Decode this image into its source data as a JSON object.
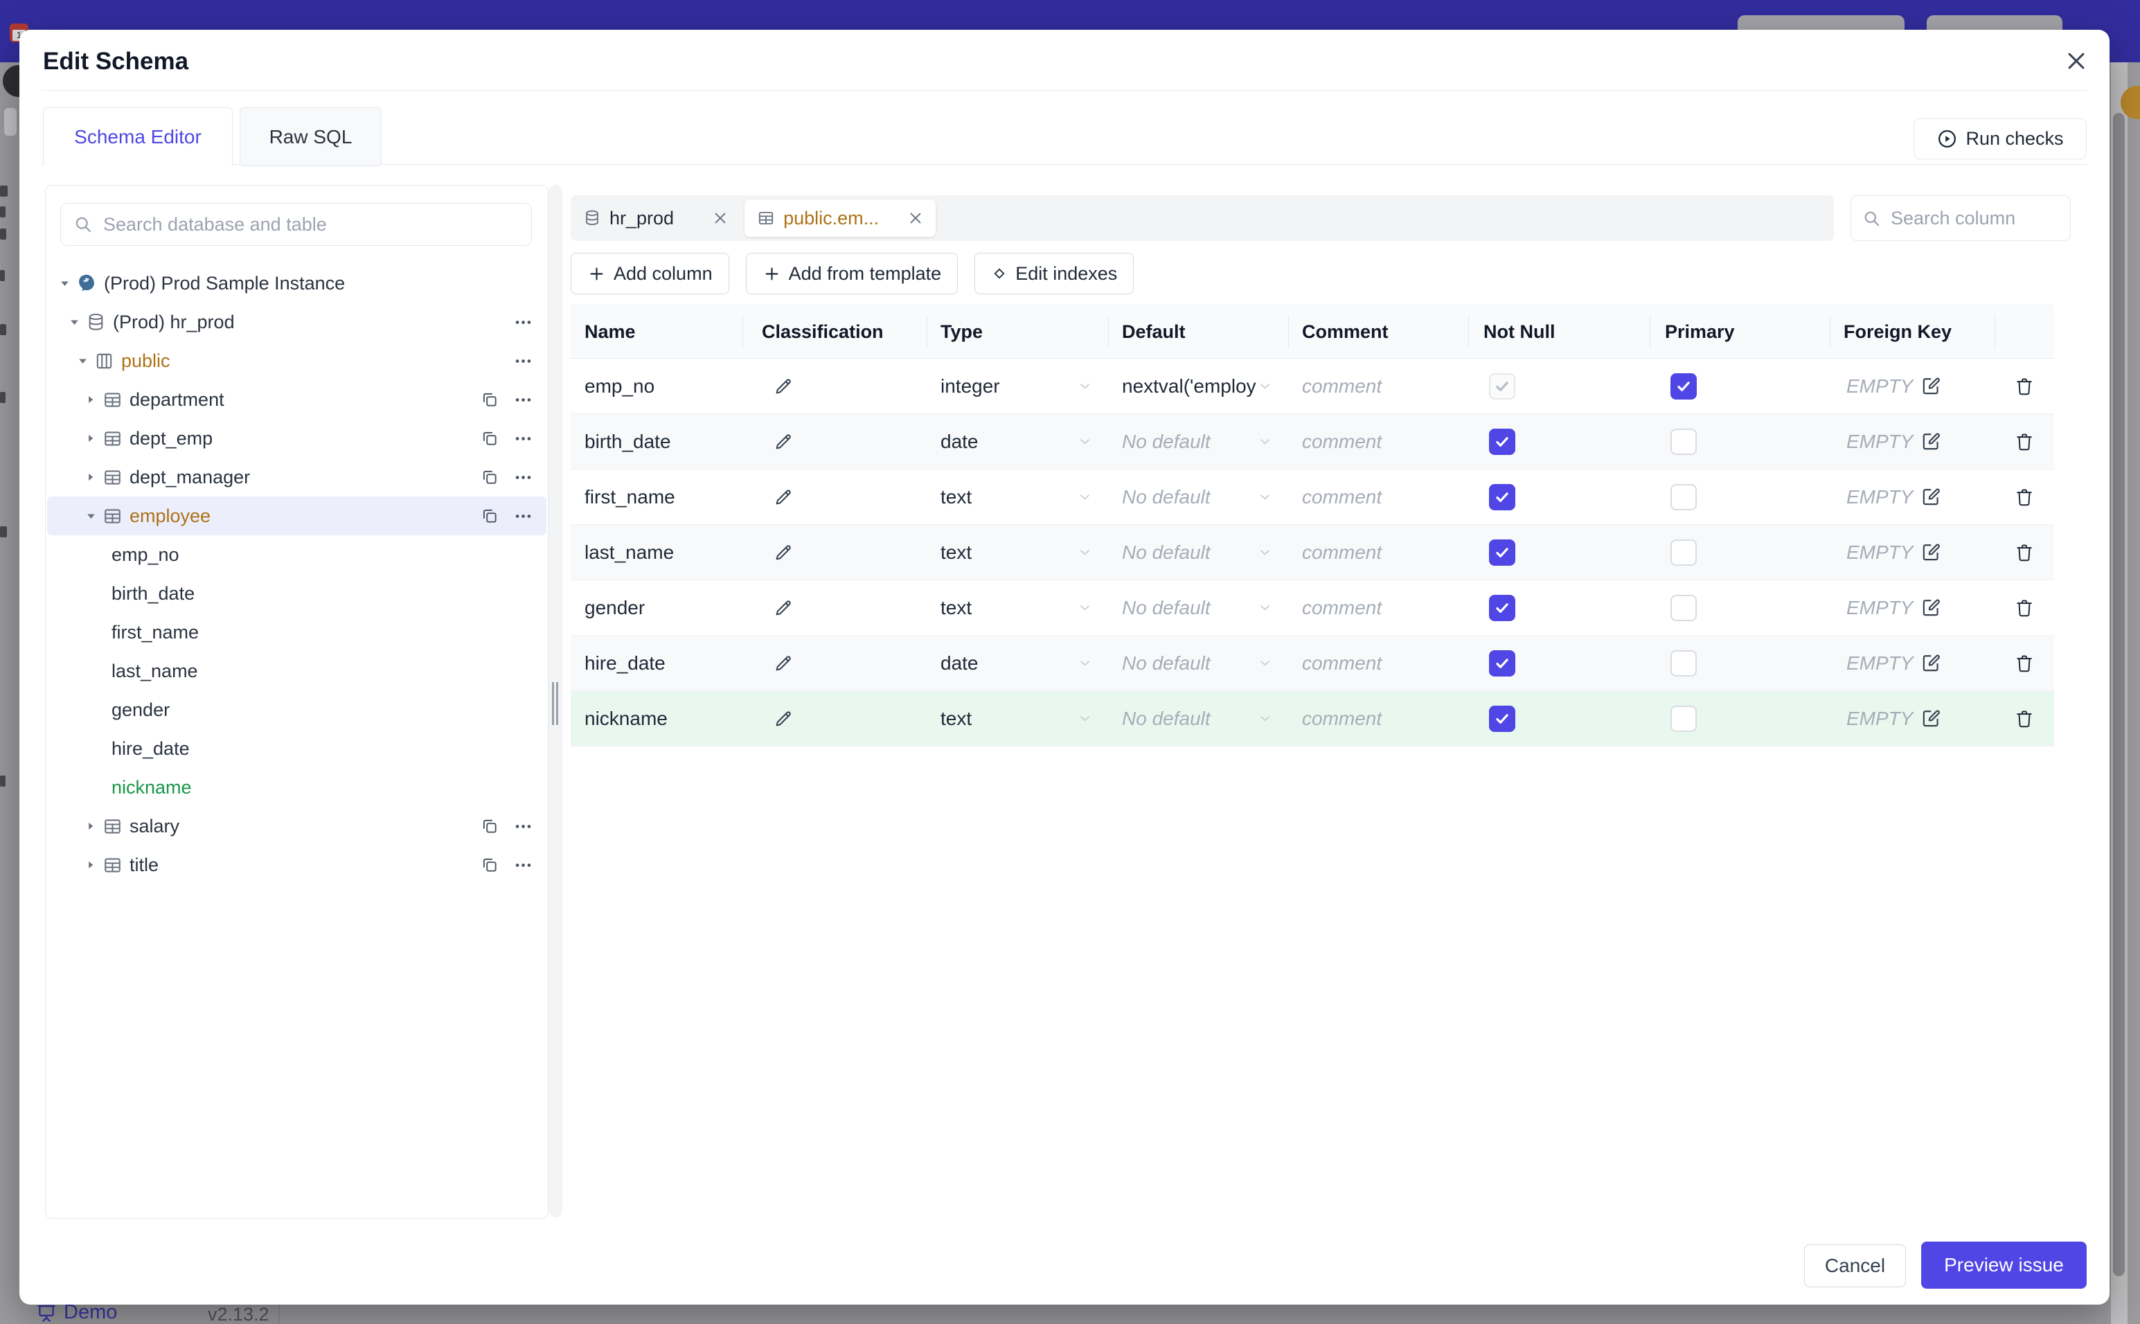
{
  "colors": {
    "accent": "#4f46e5",
    "topbar_dimmed": "#322d9e",
    "amber_highlight": "#ac7216",
    "green_new": "#1a9648",
    "new_row_bg": "#e9f8ef",
    "selected_tree_bg": "#eceefc"
  },
  "background": {
    "brand": "Demo",
    "version": "v2.13.2"
  },
  "modal": {
    "title": "Edit Schema",
    "tabs": {
      "schema_editor": "Schema Editor",
      "raw_sql": "Raw SQL"
    },
    "run_checks": "Run checks",
    "sidebar": {
      "search_placeholder": "Search database and table",
      "tree": [
        {
          "label": "(Prod) Prod Sample Instance",
          "level": 0,
          "icon": "postgresql",
          "expanded": true
        },
        {
          "label": "(Prod) hr_prod",
          "level": 1,
          "icon": "database",
          "expanded": true
        },
        {
          "label": "public",
          "level": 2,
          "icon": "schema",
          "expanded": true,
          "color": "amber"
        },
        {
          "label": "department",
          "level": 3,
          "icon": "table",
          "expanded": false
        },
        {
          "label": "dept_emp",
          "level": 3,
          "icon": "table",
          "expanded": false
        },
        {
          "label": "dept_manager",
          "level": 3,
          "icon": "table",
          "expanded": false
        },
        {
          "label": "employee",
          "level": 3,
          "icon": "table",
          "expanded": true,
          "color": "amber",
          "selected": true
        },
        {
          "label": "emp_no",
          "level": 4,
          "icon": "none"
        },
        {
          "label": "birth_date",
          "level": 4,
          "icon": "none"
        },
        {
          "label": "first_name",
          "level": 4,
          "icon": "none"
        },
        {
          "label": "last_name",
          "level": 4,
          "icon": "none"
        },
        {
          "label": "gender",
          "level": 4,
          "icon": "none"
        },
        {
          "label": "hire_date",
          "level": 4,
          "icon": "none"
        },
        {
          "label": "nickname",
          "level": 4,
          "icon": "none",
          "color": "green"
        },
        {
          "label": "salary",
          "level": 3,
          "icon": "table",
          "expanded": false
        },
        {
          "label": "title",
          "level": 3,
          "icon": "table",
          "expanded": false
        }
      ]
    },
    "editor": {
      "chips": [
        {
          "label": "hr_prod",
          "icon": "database",
          "active": false
        },
        {
          "label": "public.em...",
          "icon": "table",
          "active": true
        }
      ],
      "column_search_placeholder": "Search column",
      "toolbar": {
        "add_column": "Add column",
        "add_from_template": "Add from template",
        "edit_indexes": "Edit indexes"
      },
      "table": {
        "headers": [
          "Name",
          "Classification",
          "Type",
          "Default",
          "Comment",
          "Not Null",
          "Primary",
          "Foreign Key"
        ],
        "comment_placeholder": "comment",
        "rows": [
          {
            "name": "emp_no",
            "type": "integer",
            "default": "nextval('employ",
            "default_is_placeholder": false,
            "not_null": "checked_disabled",
            "primary": true,
            "foreign_key": "EMPTY"
          },
          {
            "name": "birth_date",
            "type": "date",
            "default": "No default",
            "default_is_placeholder": true,
            "not_null": "checked",
            "primary": false,
            "foreign_key": "EMPTY"
          },
          {
            "name": "first_name",
            "type": "text",
            "default": "No default",
            "default_is_placeholder": true,
            "not_null": "checked",
            "primary": false,
            "foreign_key": "EMPTY"
          },
          {
            "name": "last_name",
            "type": "text",
            "default": "No default",
            "default_is_placeholder": true,
            "not_null": "checked",
            "primary": false,
            "foreign_key": "EMPTY"
          },
          {
            "name": "gender",
            "type": "text",
            "default": "No default",
            "default_is_placeholder": true,
            "not_null": "checked",
            "primary": false,
            "foreign_key": "EMPTY"
          },
          {
            "name": "hire_date",
            "type": "date",
            "default": "No default",
            "default_is_placeholder": true,
            "not_null": "checked",
            "primary": false,
            "foreign_key": "EMPTY"
          },
          {
            "name": "nickname",
            "type": "text",
            "default": "No default",
            "default_is_placeholder": true,
            "not_null": "checked",
            "primary": false,
            "foreign_key": "EMPTY",
            "highlight": "new-column"
          }
        ]
      }
    },
    "footer": {
      "cancel": "Cancel",
      "preview_issue": "Preview issue"
    }
  }
}
